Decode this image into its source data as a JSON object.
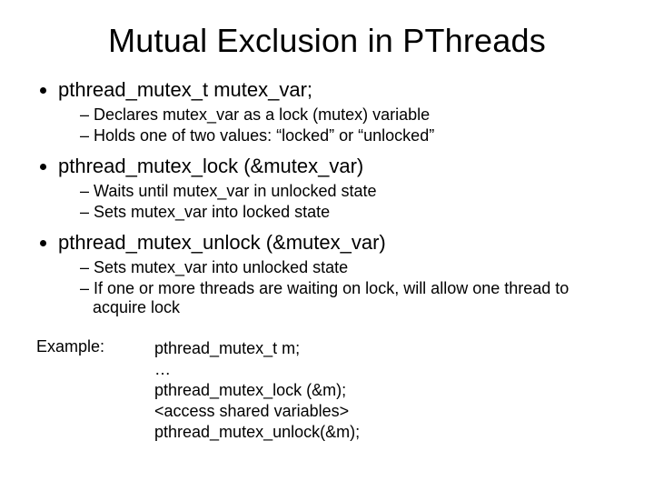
{
  "title": "Mutual Exclusion in PThreads",
  "bullets": [
    {
      "text": "pthread_mutex_t mutex_var;",
      "sub": [
        "Declares mutex_var as a lock (mutex) variable",
        "Holds one of two values: “locked” or “unlocked”"
      ]
    },
    {
      "text": "pthread_mutex_lock (&mutex_var)",
      "sub": [
        "Waits until mutex_var in unlocked state",
        "Sets mutex_var into locked state"
      ]
    },
    {
      "text": "pthread_mutex_unlock (&mutex_var)",
      "sub": [
        "Sets mutex_var into unlocked state",
        "If one or more threads are waiting on lock, will allow one thread to acquire lock"
      ]
    }
  ],
  "example": {
    "label": "Example:",
    "lines": [
      "pthread_mutex_t m;",
      "…",
      "pthread_mutex_lock (&m);",
      "<access shared variables>",
      "pthread_mutex_unlock(&m);"
    ]
  }
}
